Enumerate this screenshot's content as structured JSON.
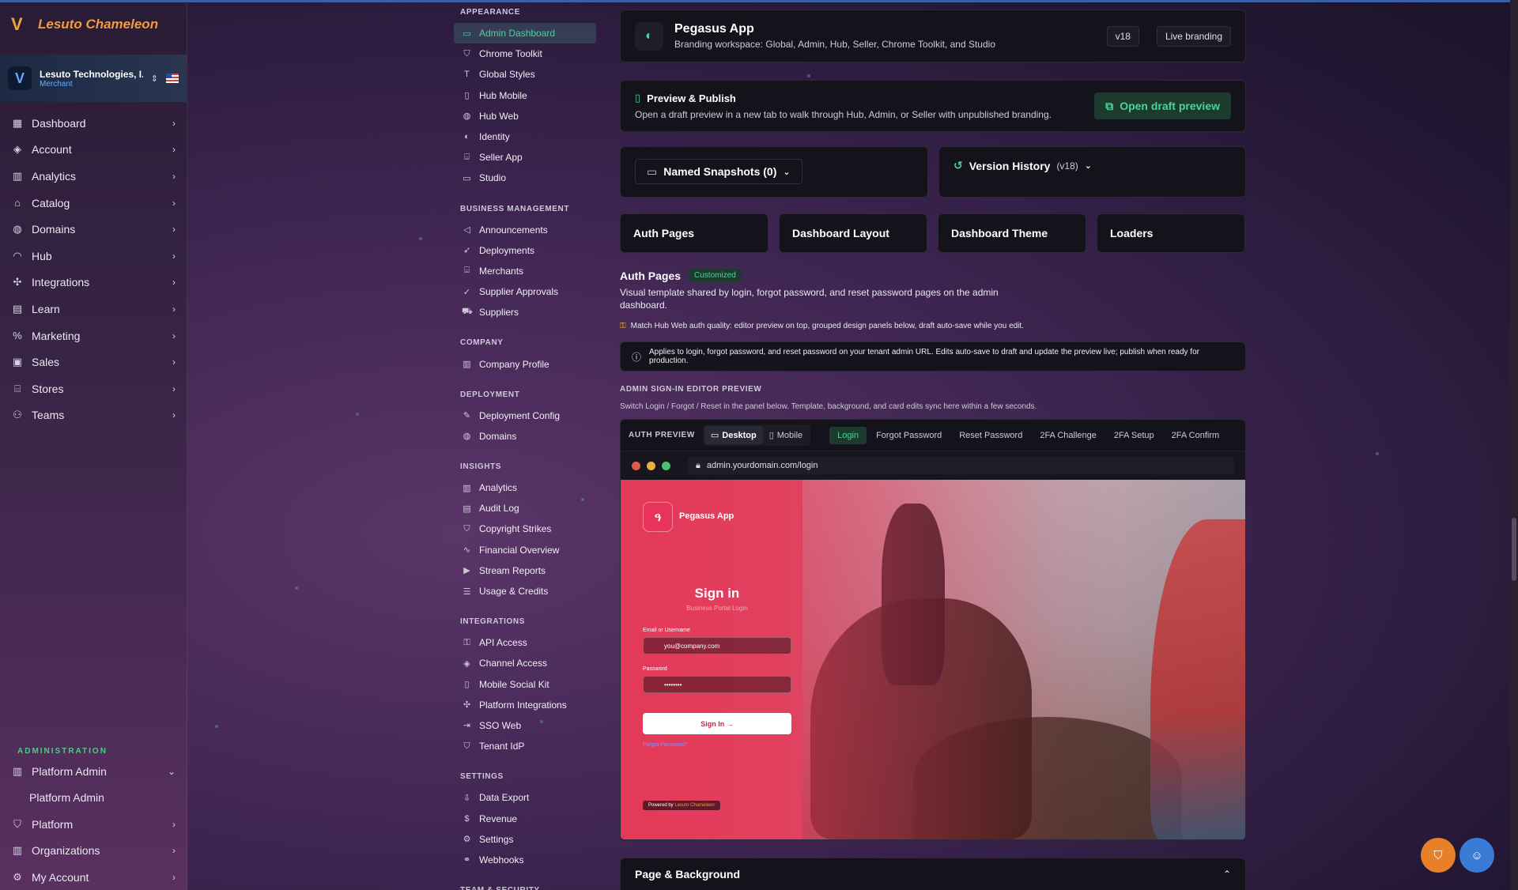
{
  "brand": {
    "name": "Lesuto Chameleon"
  },
  "tenant": {
    "name": "Lesuto Technologies, I...",
    "role": "Merchant"
  },
  "nav": [
    {
      "label": "Dashboard",
      "icon": "grid-icon"
    },
    {
      "label": "Account",
      "icon": "layers-icon"
    },
    {
      "label": "Analytics",
      "icon": "bar-chart-icon"
    },
    {
      "label": "Catalog",
      "icon": "tag-icon"
    },
    {
      "label": "Domains",
      "icon": "globe-icon"
    },
    {
      "label": "Hub",
      "icon": "rss-icon"
    },
    {
      "label": "Integrations",
      "icon": "puzzle-icon"
    },
    {
      "label": "Learn",
      "icon": "book-icon"
    },
    {
      "label": "Marketing",
      "icon": "percent-icon"
    },
    {
      "label": "Sales",
      "icon": "receipt-icon"
    },
    {
      "label": "Stores",
      "icon": "store-icon"
    },
    {
      "label": "Teams",
      "icon": "users-icon"
    }
  ],
  "admin": {
    "heading": "ADMINISTRATION",
    "items": [
      {
        "label": "Platform Admin",
        "icon": "building-icon",
        "chevron": "⌄"
      },
      {
        "label": "Platform Admin",
        "sub": true
      },
      {
        "label": "Platform",
        "icon": "shield-icon",
        "chevron": "›"
      },
      {
        "label": "Organizations",
        "icon": "building-icon",
        "chevron": "›"
      },
      {
        "label": "My Account",
        "icon": "user-gear-icon",
        "chevron": "›"
      }
    ]
  },
  "subnav": [
    {
      "heading": "APPEARANCE",
      "items": [
        {
          "label": "Admin Dashboard",
          "icon": "monitor-icon",
          "active": true
        },
        {
          "label": "Chrome Toolkit",
          "icon": "shield-icon"
        },
        {
          "label": "Global Styles",
          "icon": "type-icon"
        },
        {
          "label": "Hub Mobile",
          "icon": "phone-icon"
        },
        {
          "label": "Hub Web",
          "icon": "globe-icon"
        },
        {
          "label": "Identity",
          "icon": "palette-icon"
        },
        {
          "label": "Seller App",
          "icon": "store-icon"
        },
        {
          "label": "Studio",
          "icon": "window-icon"
        }
      ]
    },
    {
      "heading": "BUSINESS MANAGEMENT",
      "items": [
        {
          "label": "Announcements",
          "icon": "megaphone-icon"
        },
        {
          "label": "Deployments",
          "icon": "rocket-icon"
        },
        {
          "label": "Merchants",
          "icon": "store-icon"
        },
        {
          "label": "Supplier Approvals",
          "icon": "check-circle-icon"
        },
        {
          "label": "Suppliers",
          "icon": "truck-icon"
        }
      ]
    },
    {
      "heading": "COMPANY",
      "items": [
        {
          "label": "Company Profile",
          "icon": "building-icon"
        }
      ]
    },
    {
      "heading": "DEPLOYMENT",
      "items": [
        {
          "label": "Deployment Config",
          "icon": "wrench-icon"
        },
        {
          "label": "Domains",
          "icon": "globe-icon"
        }
      ]
    },
    {
      "heading": "INSIGHTS",
      "items": [
        {
          "label": "Analytics",
          "icon": "bar-chart-icon"
        },
        {
          "label": "Audit Log",
          "icon": "file-icon"
        },
        {
          "label": "Copyright Strikes",
          "icon": "shield-icon"
        },
        {
          "label": "Financial Overview",
          "icon": "activity-icon"
        },
        {
          "label": "Stream Reports",
          "icon": "video-icon"
        },
        {
          "label": "Usage & Credits",
          "icon": "database-icon"
        }
      ]
    },
    {
      "heading": "INTEGRATIONS",
      "items": [
        {
          "label": "API Access",
          "icon": "key-icon"
        },
        {
          "label": "Channel Access",
          "icon": "layers-icon"
        },
        {
          "label": "Mobile Social Kit",
          "icon": "phone-icon"
        },
        {
          "label": "Platform Integrations",
          "icon": "puzzle-icon"
        },
        {
          "label": "SSO Web",
          "icon": "login-icon"
        },
        {
          "label": "Tenant IdP",
          "icon": "shield-icon"
        }
      ]
    },
    {
      "heading": "SETTINGS",
      "items": [
        {
          "label": "Data Export",
          "icon": "download-icon"
        },
        {
          "label": "Revenue",
          "icon": "dollar-icon"
        },
        {
          "label": "Settings",
          "icon": "gear-icon"
        },
        {
          "label": "Webhooks",
          "icon": "webhook-icon"
        }
      ]
    },
    {
      "heading": "TEAM & SECURITY",
      "items": []
    }
  ],
  "app": {
    "title": "Pegasus App",
    "subtitle": "Branding workspace: Global, Admin, Hub, Seller, Chrome Toolkit, and Studio",
    "version": "v18",
    "branding": "Live branding"
  },
  "publish": {
    "title": "Preview & Publish",
    "subtitle": "Open a draft preview in a new tab to walk through Hub, Admin, or Seller with unpublished branding.",
    "button": "Open draft preview"
  },
  "snapshots": {
    "label": "Named Snapshots (0)"
  },
  "version_history": {
    "label": "Version History",
    "version": "(v18)"
  },
  "tiles": [
    "Auth Pages",
    "Dashboard Layout",
    "Dashboard Theme",
    "Loaders"
  ],
  "auth": {
    "title": "Auth Pages",
    "badge": "Customized",
    "description": "Visual template shared by login, forgot password, and reset password pages on the admin dashboard.",
    "hint": "Match Hub Web auth quality: editor preview on top, grouped design panels below, draft auto-save while you edit.",
    "info": "Applies to login, forgot password, and reset password on your tenant admin URL. Edits auto-save to draft and update the preview live; publish when ready for production."
  },
  "editor": {
    "heading": "ADMIN SIGN-IN EDITOR PREVIEW",
    "subtitle": "Switch Login / Forgot / Reset in the panel below. Template, background, and card edits sync here within a few seconds."
  },
  "preview": {
    "label": "AUTH PREVIEW",
    "devices": [
      "Desktop",
      "Mobile"
    ],
    "tabs": [
      "Login",
      "Forgot Password",
      "Reset Password",
      "2FA Challenge",
      "2FA Setup",
      "2FA Confirm"
    ],
    "url": "admin.yourdomain.com/login",
    "login": {
      "app_name": "Pegasus App",
      "title": "Sign in",
      "subtitle": "Business Portal Login",
      "email_label": "Email or Username",
      "email_placeholder": "you@company.com",
      "password_label": "Password",
      "password_value": "••••••••",
      "button": "Sign In →",
      "forgot": "Forgot Password?",
      "powered_prefix": "Powered by",
      "powered_brand": "Lesuto Chameleon"
    }
  },
  "section": {
    "title": "Page & Background"
  },
  "colors": {
    "accent": "#4fd19a",
    "brand": "#f59a3a",
    "login_bg": "#e43a5a"
  }
}
